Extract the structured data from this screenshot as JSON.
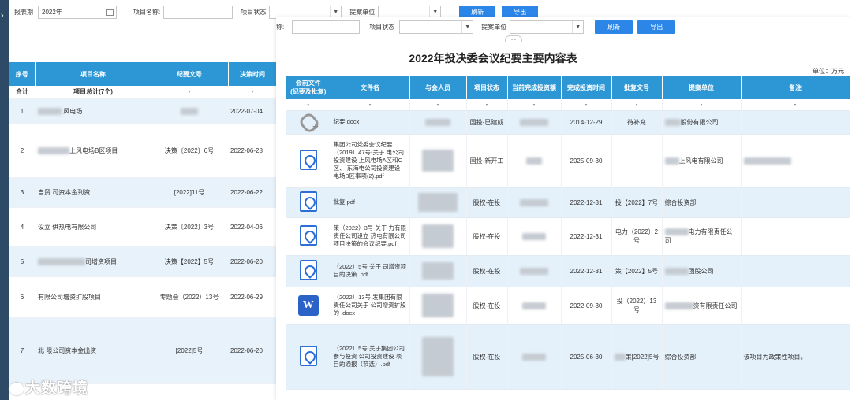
{
  "back_filter": {
    "period_label": "报表期",
    "period_value": "2022年",
    "project_name_label": "项目名称:",
    "project_status_label": "项目状态",
    "proposer_label": "提案单位",
    "refresh_label": "刷新",
    "export_label": "导出"
  },
  "front_filter": {
    "name_label": "称:",
    "project_status_label": "项目状态",
    "proposer_label": "提案单位",
    "refresh_label": "刷新",
    "export_label": "导出"
  },
  "back_table": {
    "headers": [
      "序号",
      "项目名称",
      "纪要文号",
      "决策时间"
    ],
    "total": {
      "label": "合计",
      "name": "项目总计(7个)",
      "doc": "-",
      "date": "-"
    },
    "rows": [
      {
        "no": "1",
        "name": "风电场",
        "doc": "",
        "date": "2022-07-04"
      },
      {
        "no": "2",
        "name": "上风电场B区项目",
        "doc": "决策〔2022〕6号",
        "date": "2022-06-28"
      },
      {
        "no": "3",
        "name": "自贸    司资本金到资",
        "doc": "[2022]11号",
        "date": "2022-06-22"
      },
      {
        "no": "4",
        "name": "设立    供热电有限公司",
        "doc": "决策〔2022〕3号",
        "date": "2022-04-06"
      },
      {
        "no": "5",
        "name": "司增资项目",
        "doc": "决策【2022】5号",
        "date": "2022-06-20"
      },
      {
        "no": "6",
        "name": "有限公司增资扩股项目",
        "doc": "专题会（2022）13号",
        "date": "2022-06-29"
      },
      {
        "no": "7",
        "name": "北    限公司资本金出资",
        "doc": "[2022]5号",
        "date": "2022-06-20"
      }
    ]
  },
  "main": {
    "title": "2022年投决委会议纪要主要内容表",
    "unit": "单位：万元",
    "collapse_glyph": "︿",
    "headers": [
      "会前文件\n(纪要及批复)",
      "文件名",
      "与会人员",
      "项目状态",
      "当前完成投资额",
      "完成投资时间",
      "批复文号",
      "提案单位",
      "备注"
    ],
    "sum_row": [
      "-",
      "-",
      "-",
      "-",
      "-",
      "-",
      "-",
      "-",
      "-"
    ],
    "rows": [
      {
        "icon": "paperclip-icon",
        "file": "纪要.docx",
        "status": "国投-已建成",
        "time": "2014-12-29",
        "approval": "待补充",
        "proposer": "股份有限公司",
        "note": ""
      },
      {
        "icon": "pdf-icon",
        "file": "集团公司党委会议纪要（2019）47号-关于    电公司投资建设    上风电场A区和C区、    东海电公司投资建设    电场B区事项(2).pdf",
        "status": "国投-新开工",
        "time": "2025-09-30",
        "approval": "",
        "proposer": "上风电有限公司",
        "note": ""
      },
      {
        "icon": "pdf-icon",
        "file": "批复.pdf",
        "status": "股权-在投",
        "time": "2022-12-31",
        "approval": "投【2022】7号",
        "proposer": "综合投资部",
        "note": ""
      },
      {
        "icon": "pdf-icon",
        "file": "策（2022）3号 关于    力有限责任公司设立    热电有限公司项目决策的会议纪要.pdf",
        "status": "股权-在投",
        "time": "2022-12-31",
        "approval": "电力（2022）2号",
        "proposer": "电力有限责任公司",
        "note": ""
      },
      {
        "icon": "pdf-icon",
        "file": "（2022）5号 关于    司增资项目的决策    .pdf",
        "status": "股权-在投",
        "time": "2022-12-31",
        "approval": "策【2022】5号",
        "proposer": "团股公司",
        "note": ""
      },
      {
        "icon": "word-icon",
        "file": "（2022）13号    发集团有限责任公司关于    公司增资扩股的    .docx",
        "status": "股权-在投",
        "time": "2022-09-30",
        "approval": "投（2022）13号",
        "proposer": "资有限责任公司",
        "note": ""
      },
      {
        "icon": "pdf-icon",
        "file": "（2022）5号 关于集团公司参与投资    公司投资建设    项目的通报（节选）.pdf",
        "status": "股权-在投",
        "time": "2025-06-30",
        "approval": "策[2022]5号",
        "proposer": "综合投资部",
        "note": "该项目为政策性项目。"
      }
    ]
  },
  "watermark": "大数跨境"
}
